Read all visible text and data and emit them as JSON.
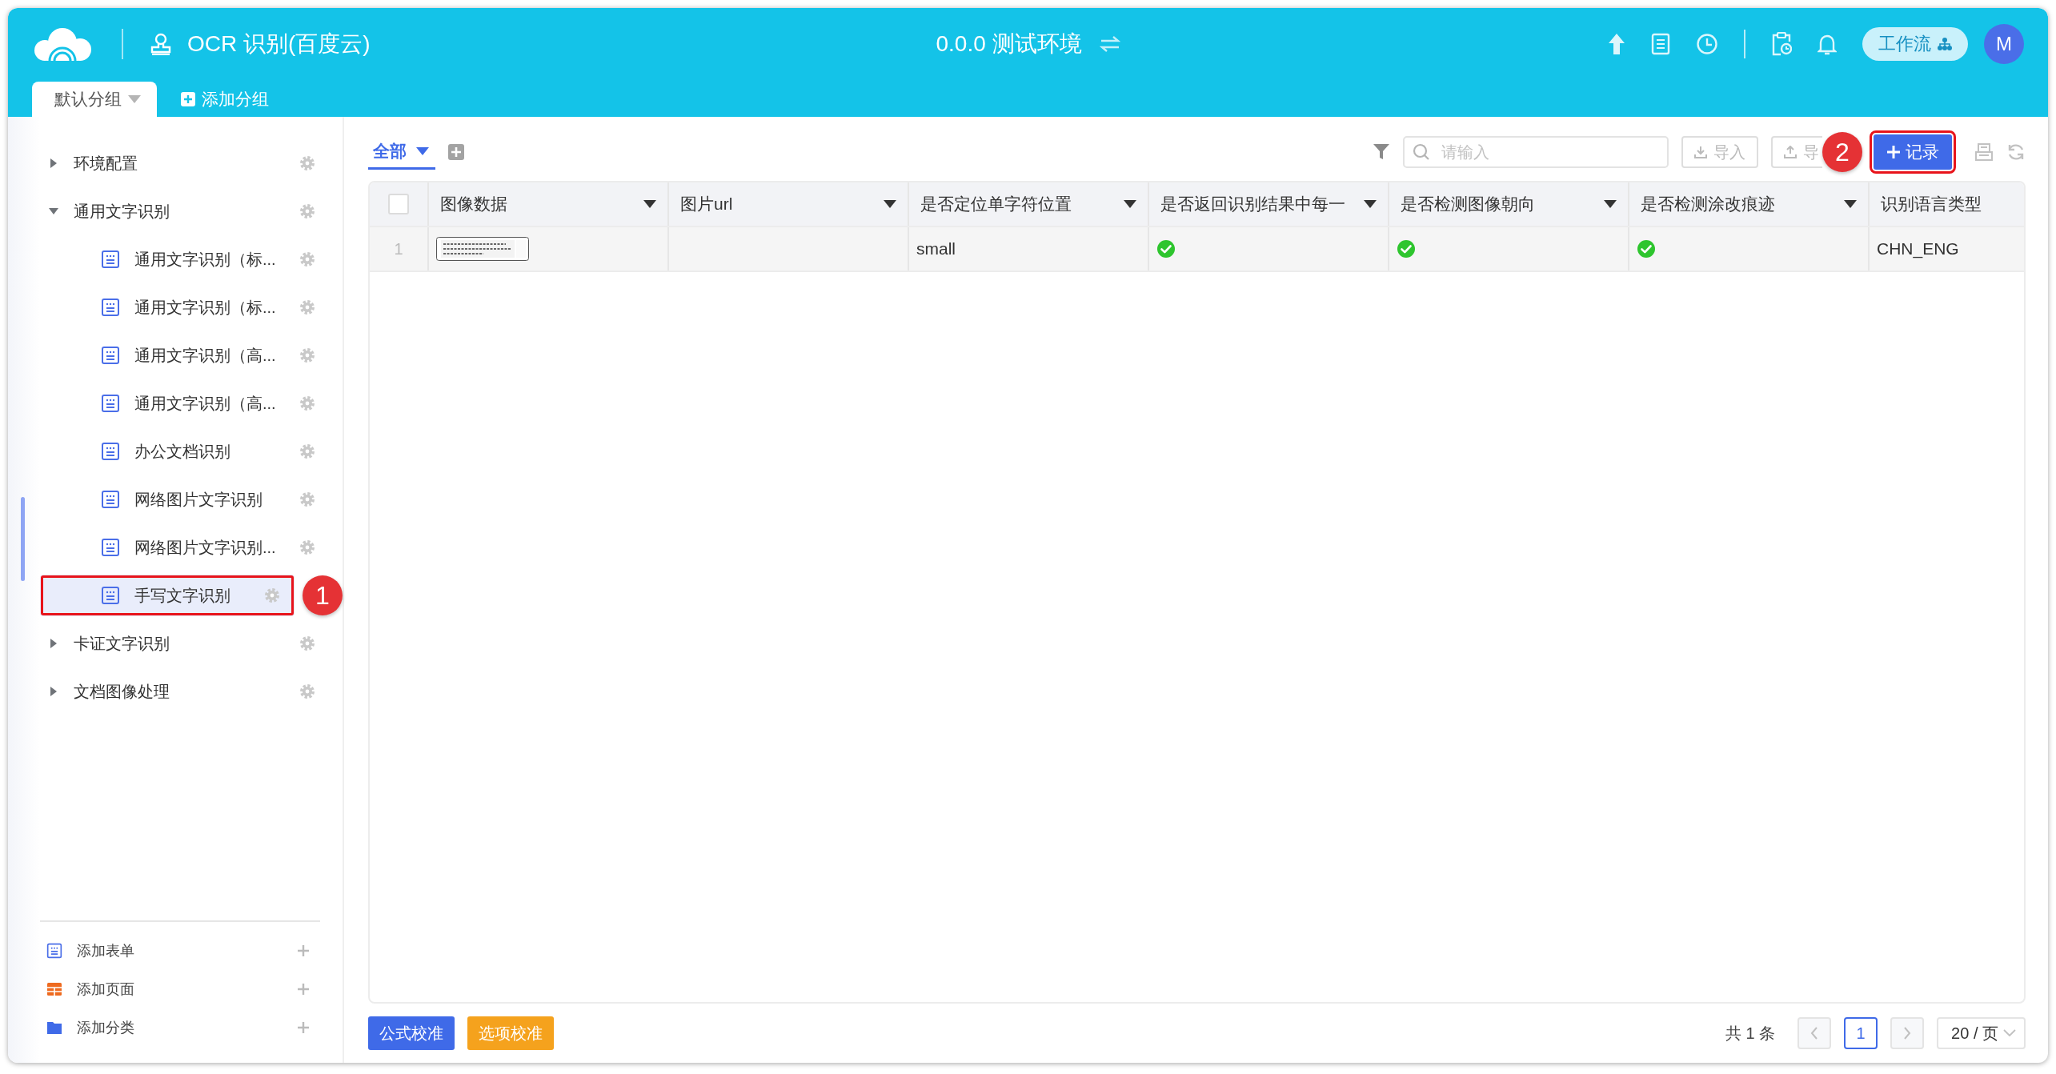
{
  "header": {
    "title": "OCR 识别(百度云)",
    "environment": "0.0.0 测试环境",
    "workflow_button": "工作流",
    "avatar": "M"
  },
  "group_tabs": [
    {
      "label": "默认分组",
      "selected": true
    }
  ],
  "add_group": "添加分组",
  "sidebar": {
    "items": [
      {
        "kind": "folder",
        "label": "环境配置",
        "expanded": false
      },
      {
        "kind": "folder",
        "label": "通用文字识别",
        "expanded": true,
        "children": [
          {
            "kind": "form",
            "label": "通用文字识别（标...",
            "selected": false
          },
          {
            "kind": "form",
            "label": "通用文字识别（标...",
            "selected": false
          },
          {
            "kind": "form",
            "label": "通用文字识别（高...",
            "selected": false
          },
          {
            "kind": "form",
            "label": "通用文字识别（高...",
            "selected": false
          },
          {
            "kind": "form",
            "label": "办公文档识别",
            "selected": false
          },
          {
            "kind": "form",
            "label": "网络图片文字识别",
            "selected": false
          },
          {
            "kind": "form",
            "label": "网络图片文字识别...",
            "selected": false
          },
          {
            "kind": "form",
            "label": "手写文字识别",
            "selected": true,
            "marker": "1"
          }
        ]
      },
      {
        "kind": "folder",
        "label": "卡证文字识别",
        "expanded": false
      },
      {
        "kind": "folder",
        "label": "文档图像处理",
        "expanded": false
      }
    ],
    "actions": [
      {
        "kind": "form",
        "label": "添加表单"
      },
      {
        "kind": "page",
        "label": "添加页面"
      },
      {
        "kind": "category",
        "label": "添加分类"
      }
    ]
  },
  "view_tab": {
    "label": "全部",
    "selected": true
  },
  "search": {
    "placeholder": "请输入"
  },
  "import_button": "导入",
  "export_button": "导",
  "add_record_button": {
    "label": "记录",
    "marker": "2"
  },
  "table": {
    "select_all": {
      "checked": false
    },
    "columns": [
      {
        "label": "图像数据",
        "menu": true
      },
      {
        "label": "图片url",
        "menu": true
      },
      {
        "label": "是否定位单字符位置",
        "menu": true
      },
      {
        "label": "是否返回识别结果中每一",
        "menu": true
      },
      {
        "label": "是否检测图像朝向",
        "menu": true
      },
      {
        "label": "是否检测涂改痕迹",
        "menu": true
      },
      {
        "label": "识别语言类型",
        "menu": false
      }
    ],
    "rows": [
      {
        "index": "1",
        "cells": [
          {
            "kind": "picture"
          },
          {
            "kind": "empty"
          },
          {
            "kind": "text",
            "text": "small"
          },
          {
            "kind": "check",
            "checked": true
          },
          {
            "kind": "check",
            "checked": true
          },
          {
            "kind": "check",
            "checked": true
          },
          {
            "kind": "text",
            "text": "CHN_ENG"
          }
        ]
      }
    ]
  },
  "footer_buttons": [
    {
      "kind": "primary",
      "label": "公式校准"
    },
    {
      "kind": "warning",
      "label": "选项校准"
    }
  ],
  "pagination": {
    "total": "共 1 条",
    "pages": [
      {
        "label": "1",
        "selected": true
      }
    ],
    "page_size": "20 / 页"
  }
}
